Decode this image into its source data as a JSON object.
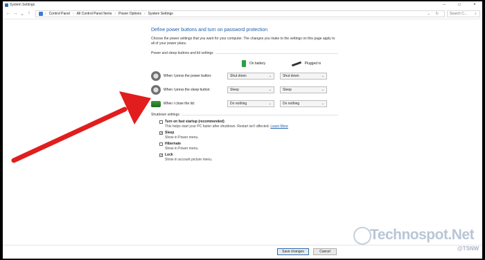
{
  "window": {
    "title": "System Settings"
  },
  "address": {
    "crumbs": [
      "Control Panel",
      "All Control Panel Items",
      "Power Options",
      "System Settings"
    ],
    "separator": "›",
    "search_placeholder": "Search C..."
  },
  "main": {
    "heading": "Define power buttons and turn on password protection",
    "description": "Choose the power settings that you want for your computer. The changes you make to the settings on this page apply to all of your power plans.",
    "section_title": "Power and sleep buttons and lid settings",
    "col_battery": "On battery",
    "col_plugged": "Plugged in",
    "rows": [
      {
        "label": "When I press the power button:",
        "battery": "Shut down",
        "plugged": "Shut down"
      },
      {
        "label": "When I press the sleep button:",
        "battery": "Sleep",
        "plugged": "Sleep"
      },
      {
        "label": "When I close the lid:",
        "battery": "Do nothing",
        "plugged": "Do nothing"
      }
    ],
    "shutdown_title": "Shutdown settings",
    "shutdown": [
      {
        "label": "Turn on fast startup (recommended)",
        "checked": false,
        "desc": "This helps start your PC faster after shutdown. Restart isn't affected.",
        "link": "Learn More"
      },
      {
        "label": "Sleep",
        "checked": true,
        "desc": "Show in Power menu."
      },
      {
        "label": "Hibernate",
        "checked": false,
        "desc": "Show in Power menu."
      },
      {
        "label": "Lock",
        "checked": true,
        "desc": "Show in account picture menu."
      }
    ]
  },
  "footer": {
    "save_label": "Save changes",
    "cancel_label": "Cancel"
  },
  "watermark": {
    "brand": "Technospot.Net",
    "tag": "@TSNW"
  },
  "colors": {
    "heading": "#1f5fa8",
    "arrow": "#e11d1d",
    "battery": "#2ea043"
  }
}
